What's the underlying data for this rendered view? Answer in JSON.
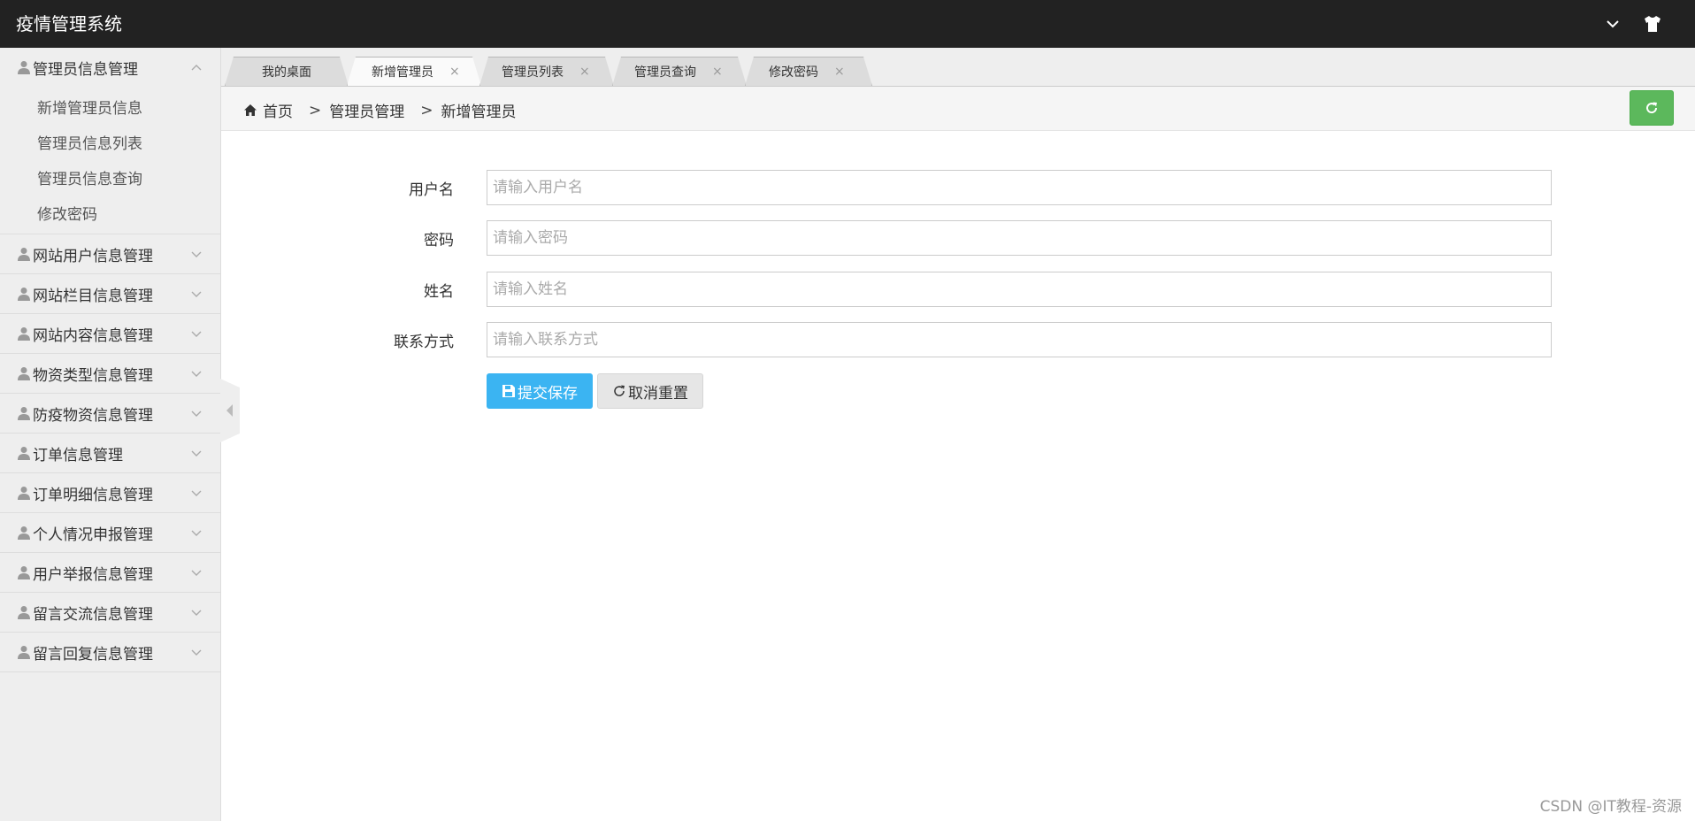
{
  "app": {
    "title": "疫情管理系统"
  },
  "header": {
    "dropdown_icon": "chevron-down-icon",
    "theme_icon": "tshirt-icon"
  },
  "sidebar": {
    "groups": [
      {
        "label": "管理员信息管理",
        "expanded": true,
        "items": [
          "新增管理员信息",
          "管理员信息列表",
          "管理员信息查询",
          "修改密码"
        ]
      },
      {
        "label": "网站用户信息管理"
      },
      {
        "label": "网站栏目信息管理"
      },
      {
        "label": "网站内容信息管理"
      },
      {
        "label": "物资类型信息管理"
      },
      {
        "label": "防疫物资信息管理"
      },
      {
        "label": "订单信息管理"
      },
      {
        "label": "订单明细信息管理"
      },
      {
        "label": "个人情况申报管理"
      },
      {
        "label": "用户举报信息管理"
      },
      {
        "label": "留言交流信息管理"
      },
      {
        "label": "留言回复信息管理"
      }
    ]
  },
  "tabs": [
    {
      "label": "我的桌面",
      "closable": false,
      "active": false
    },
    {
      "label": "新增管理员",
      "closable": true,
      "active": true
    },
    {
      "label": "管理员列表",
      "closable": true,
      "active": false
    },
    {
      "label": "管理员查询",
      "closable": true,
      "active": false
    },
    {
      "label": "修改密码",
      "closable": true,
      "active": false
    }
  ],
  "tab_close_glyph": "×",
  "breadcrumb": {
    "home": "首页",
    "sep1": ">",
    "level1": "管理员管理",
    "sep2": ">",
    "level2": "新增管理员"
  },
  "form": {
    "username": {
      "label": "用户名",
      "placeholder": "请输入用户名",
      "value": ""
    },
    "password": {
      "label": "密码",
      "placeholder": "请输入密码",
      "value": ""
    },
    "realname": {
      "label": "姓名",
      "placeholder": "请输入姓名",
      "value": ""
    },
    "contact": {
      "label": "联系方式",
      "placeholder": "请输入联系方式",
      "value": ""
    },
    "submit_label": "提交保存",
    "reset_label": "取消重置"
  },
  "colors": {
    "topbar": "#222222",
    "submit": "#3bb4f2",
    "refresh": "#5cb85c"
  },
  "watermark": "CSDN @IT教程-资源"
}
